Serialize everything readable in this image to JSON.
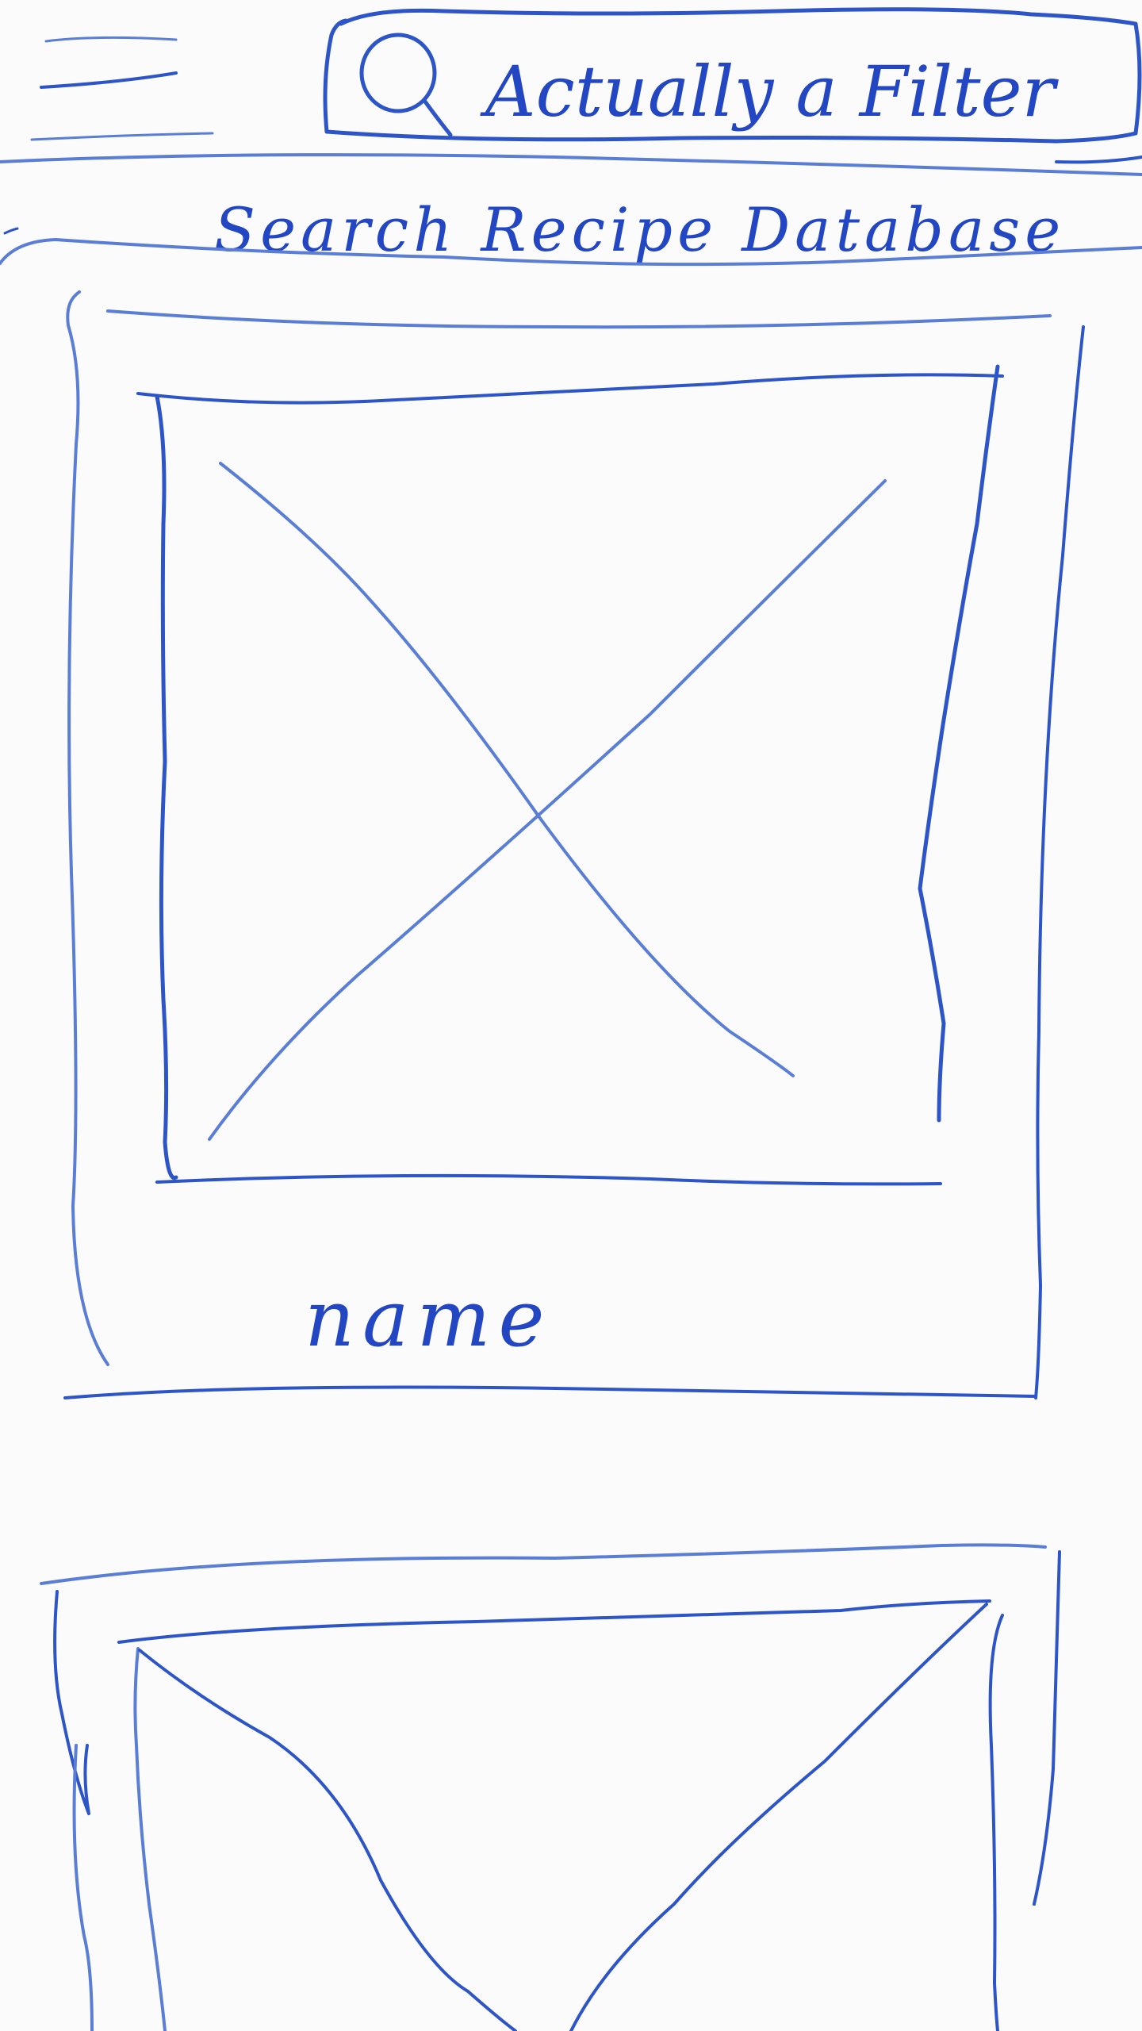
{
  "header": {
    "menu_icon": "hamburger-menu-icon",
    "search_icon": "search-icon",
    "search_placeholder": "Actually a Filter"
  },
  "page": {
    "title": "Search Recipe Database"
  },
  "recipe_cards": [
    {
      "image_placeholder": "image-placeholder",
      "name": "name"
    },
    {
      "image_placeholder": "image-placeholder"
    }
  ],
  "colors": {
    "ink": "#2d55c8",
    "ink_light": "#5a7ed6",
    "background": "#fbfbfb"
  }
}
